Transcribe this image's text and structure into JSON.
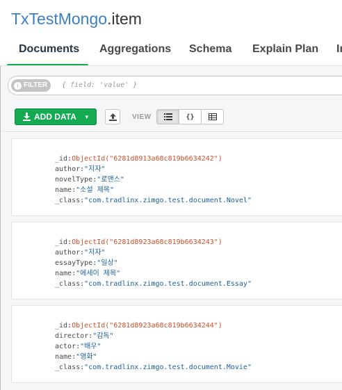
{
  "title": {
    "database": "TxTestMongo",
    "collection": ".item"
  },
  "tabs": [
    {
      "label": "Documents",
      "active": true
    },
    {
      "label": "Aggregations"
    },
    {
      "label": "Schema"
    },
    {
      "label": "Explain Plan"
    },
    {
      "label": "In"
    }
  ],
  "filter": {
    "badge": "FILTER",
    "placeholder": "{ field: 'value' }"
  },
  "toolbar": {
    "add_data": "ADD DATA",
    "view_label": "VIEW"
  },
  "icons": {
    "info": "info-icon",
    "download": "download-icon",
    "upload": "upload-icon",
    "list_view": "list-view-icon",
    "json_view": "json-view-icon",
    "table_view": "table-view-icon"
  },
  "colors": {
    "accent": "#13aa52",
    "db_title": "#3a7fc1",
    "objectid": "#d04d27",
    "string": "#1a5f9e"
  },
  "documents": [
    {
      "fields": [
        {
          "key": "_id",
          "value": "ObjectId(\"6281d8913a68c819b6634242\")",
          "type": "oid"
        },
        {
          "key": "author",
          "value": "\"저자\"",
          "type": "str"
        },
        {
          "key": "novelType",
          "value": "\"로맨스\"",
          "type": "str"
        },
        {
          "key": "name",
          "value": "\"소설 제목\"",
          "type": "str"
        },
        {
          "key": "_class",
          "value": "\"com.tradlinx.zimgo.test.document.Novel\"",
          "type": "str"
        }
      ]
    },
    {
      "fields": [
        {
          "key": "_id",
          "value": "ObjectId(\"6281d8923a68c819b6634243\")",
          "type": "oid"
        },
        {
          "key": "author",
          "value": "\"저자\"",
          "type": "str"
        },
        {
          "key": "essayType",
          "value": "\"일상\"",
          "type": "str"
        },
        {
          "key": "name",
          "value": "\"에세이 제목\"",
          "type": "str"
        },
        {
          "key": "_class",
          "value": "\"com.tradlinx.zimgo.test.document.Essay\"",
          "type": "str"
        }
      ]
    },
    {
      "fields": [
        {
          "key": "_id",
          "value": "ObjectId(\"6281d8923a68c819b6634244\")",
          "type": "oid"
        },
        {
          "key": "director",
          "value": "\"감독\"",
          "type": "str"
        },
        {
          "key": "actor",
          "value": "\"배우\"",
          "type": "str"
        },
        {
          "key": "name",
          "value": "\"영화\"",
          "type": "str"
        },
        {
          "key": "_class",
          "value": "\"com.tradlinx.zimgo.test.document.Movie\"",
          "type": "str"
        }
      ]
    }
  ]
}
